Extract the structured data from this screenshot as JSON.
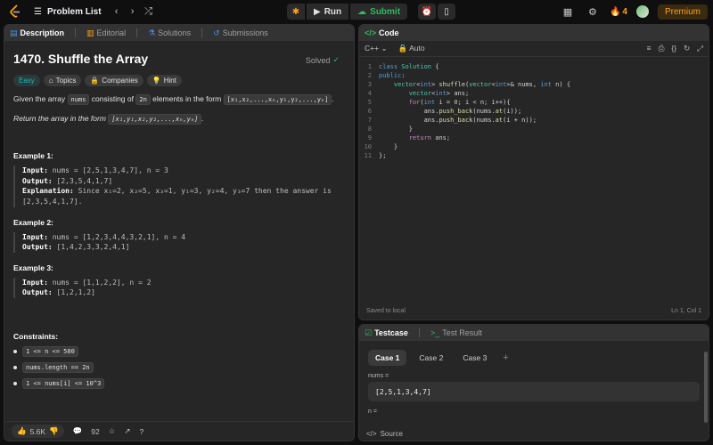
{
  "topbar": {
    "problem_list": "Problem List",
    "run": "Run",
    "submit": "Submit",
    "streak": "4",
    "premium": "Premium"
  },
  "left_tabs": [
    "Description",
    "Editorial",
    "Solutions",
    "Submissions"
  ],
  "description": {
    "title": "1470. Shuffle the Array",
    "solved": "Solved",
    "badges": [
      "Easy",
      "Topics",
      "Companies",
      "Hint"
    ],
    "para1_a": "Given the array",
    "para1_code1": "nums",
    "para1_b": "consisting of",
    "para1_code2": "2n",
    "para1_c": "elements in the form",
    "para1_code3": "[x₁,x₂,...,xₙ,y₁,y₂,...,yₙ]",
    "para2_a": "Return the array in the form",
    "para2_code": "[x₁,y₁,x₂,y₂,...,xₙ,yₙ]",
    "examples": [
      {
        "title": "Example 1:",
        "input": "nums = [2,5,1,3,4,7], n = 3",
        "output": "[2,3,5,4,1,7]",
        "explanation": "Since x₁=2, x₂=5, x₃=1, y₁=3, y₂=4, y₃=7 then the answer is [2,3,5,4,1,7]."
      },
      {
        "title": "Example 2:",
        "input": "nums = [1,2,3,4,4,3,2,1], n = 4",
        "output": "[1,4,2,3,3,2,4,1]"
      },
      {
        "title": "Example 3:",
        "input": "nums = [1,1,2,2], n = 2",
        "output": "[1,2,1,2]"
      }
    ],
    "labels": {
      "input": "Input:",
      "output": "Output:",
      "explanation": "Explanation:"
    },
    "constraints_title": "Constraints:",
    "constraints": [
      "1 <= n <= 500",
      "nums.length == 2n",
      "1 <= nums[i] <= 10^3"
    ],
    "footer": {
      "likes": "5.6K",
      "comments": "92"
    }
  },
  "code": {
    "title": "Code",
    "language": "C++",
    "mode": "Auto",
    "saved": "Saved to local",
    "cursor": "Ln 1, Col 1"
  },
  "testcase": {
    "tab1": "Testcase",
    "tab2": "Test Result",
    "cases": [
      "Case 1",
      "Case 2",
      "Case 3"
    ],
    "field1_label": "nums =",
    "field1_value": "[2,5,1,3,4,7]",
    "field2_label": "n =",
    "source": "Source"
  }
}
